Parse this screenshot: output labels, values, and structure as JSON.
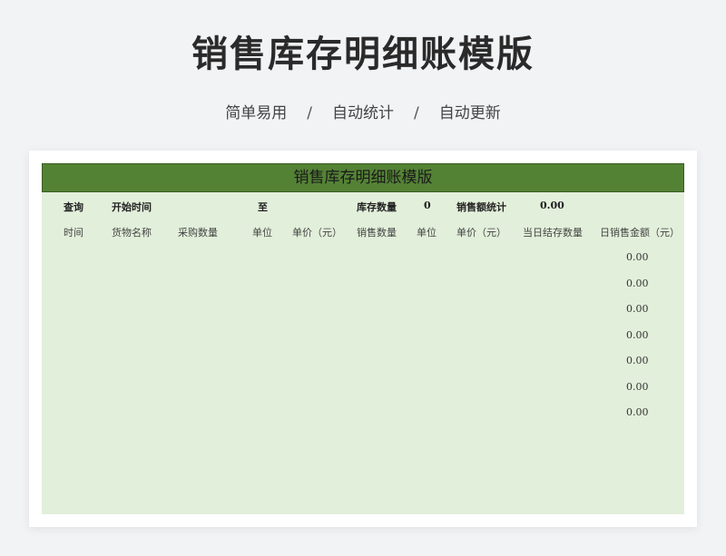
{
  "page": {
    "title": "销售库存明细账模版",
    "features": [
      "简单易用",
      "自动统计",
      "自动更新"
    ],
    "separator": "/"
  },
  "sheet": {
    "title": "销售库存明细账模版",
    "query_row": {
      "query_label": "查询",
      "start_time_label": "开始时间",
      "to_label": "至",
      "stock_qty_label": "库存数量",
      "stock_qty_value": "0",
      "sales_total_label": "销售额统计",
      "sales_total_value": "0.00"
    },
    "columns": [
      "时间",
      "货物名称",
      "采购数量",
      "单位",
      "单价（元）",
      "销售数量",
      "单位",
      "单价（元）",
      "当日结存数量",
      "日销售金额（元）"
    ],
    "daily_sales_values": [
      "0.00",
      "0.00",
      "0.00",
      "0.00",
      "0.00",
      "0.00",
      "0.00"
    ]
  },
  "colors": {
    "header_green": "#548235",
    "sheet_bg": "#e2efda",
    "page_bg": "#f2f3f5"
  }
}
